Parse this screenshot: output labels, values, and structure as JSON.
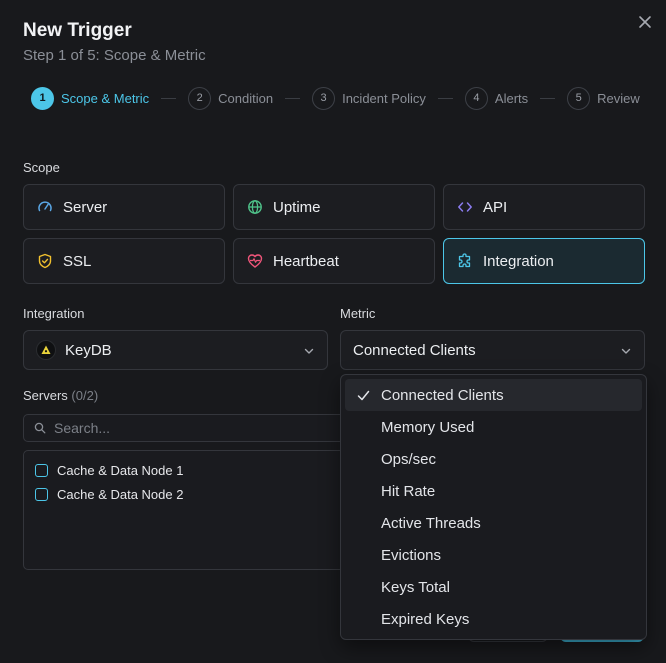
{
  "modal": {
    "title": "New Trigger",
    "subtitle": "Step 1 of 5: Scope & Metric"
  },
  "steps": [
    {
      "num": "1",
      "label": "Scope & Metric",
      "active": true
    },
    {
      "num": "2",
      "label": "Condition"
    },
    {
      "num": "3",
      "label": "Incident Policy"
    },
    {
      "num": "4",
      "label": "Alerts"
    },
    {
      "num": "5",
      "label": "Review"
    }
  ],
  "scope": {
    "label": "Scope",
    "options": [
      {
        "label": "Server",
        "icon": "gauge-icon"
      },
      {
        "label": "Uptime",
        "icon": "globe-icon"
      },
      {
        "label": "API",
        "icon": "code-icon"
      },
      {
        "label": "SSL",
        "icon": "shield-icon"
      },
      {
        "label": "Heartbeat",
        "icon": "heart-pulse-icon"
      },
      {
        "label": "Integration",
        "icon": "puzzle-icon",
        "selected": true
      }
    ]
  },
  "integration": {
    "label": "Integration",
    "value": "KeyDB"
  },
  "metric": {
    "label": "Metric",
    "value": "Connected Clients",
    "options": [
      "Connected Clients",
      "Memory Used",
      "Ops/sec",
      "Hit Rate",
      "Active Threads",
      "Evictions",
      "Keys Total",
      "Expired Keys"
    ],
    "selected": "Connected Clients"
  },
  "servers": {
    "label": "Servers",
    "count": "(0/2)",
    "search_placeholder": "Search...",
    "items": [
      "Cache & Data Node 1",
      "Cache & Data Node 2"
    ]
  },
  "colors": {
    "accent": "#4cc6e8",
    "background": "#18191c"
  }
}
